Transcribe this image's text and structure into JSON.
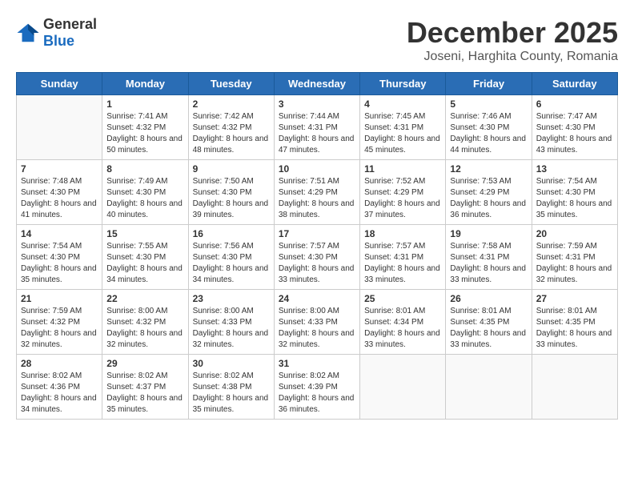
{
  "logo": {
    "general": "General",
    "blue": "Blue"
  },
  "title": "December 2025",
  "subtitle": "Joseni, Harghita County, Romania",
  "weekdays": [
    "Sunday",
    "Monday",
    "Tuesday",
    "Wednesday",
    "Thursday",
    "Friday",
    "Saturday"
  ],
  "weeks": [
    [
      {
        "day": "",
        "sunrise": "",
        "sunset": "",
        "daylight": ""
      },
      {
        "day": "1",
        "sunrise": "Sunrise: 7:41 AM",
        "sunset": "Sunset: 4:32 PM",
        "daylight": "Daylight: 8 hours and 50 minutes."
      },
      {
        "day": "2",
        "sunrise": "Sunrise: 7:42 AM",
        "sunset": "Sunset: 4:32 PM",
        "daylight": "Daylight: 8 hours and 48 minutes."
      },
      {
        "day": "3",
        "sunrise": "Sunrise: 7:44 AM",
        "sunset": "Sunset: 4:31 PM",
        "daylight": "Daylight: 8 hours and 47 minutes."
      },
      {
        "day": "4",
        "sunrise": "Sunrise: 7:45 AM",
        "sunset": "Sunset: 4:31 PM",
        "daylight": "Daylight: 8 hours and 45 minutes."
      },
      {
        "day": "5",
        "sunrise": "Sunrise: 7:46 AM",
        "sunset": "Sunset: 4:30 PM",
        "daylight": "Daylight: 8 hours and 44 minutes."
      },
      {
        "day": "6",
        "sunrise": "Sunrise: 7:47 AM",
        "sunset": "Sunset: 4:30 PM",
        "daylight": "Daylight: 8 hours and 43 minutes."
      }
    ],
    [
      {
        "day": "7",
        "sunrise": "Sunrise: 7:48 AM",
        "sunset": "Sunset: 4:30 PM",
        "daylight": "Daylight: 8 hours and 41 minutes."
      },
      {
        "day": "8",
        "sunrise": "Sunrise: 7:49 AM",
        "sunset": "Sunset: 4:30 PM",
        "daylight": "Daylight: 8 hours and 40 minutes."
      },
      {
        "day": "9",
        "sunrise": "Sunrise: 7:50 AM",
        "sunset": "Sunset: 4:30 PM",
        "daylight": "Daylight: 8 hours and 39 minutes."
      },
      {
        "day": "10",
        "sunrise": "Sunrise: 7:51 AM",
        "sunset": "Sunset: 4:29 PM",
        "daylight": "Daylight: 8 hours and 38 minutes."
      },
      {
        "day": "11",
        "sunrise": "Sunrise: 7:52 AM",
        "sunset": "Sunset: 4:29 PM",
        "daylight": "Daylight: 8 hours and 37 minutes."
      },
      {
        "day": "12",
        "sunrise": "Sunrise: 7:53 AM",
        "sunset": "Sunset: 4:29 PM",
        "daylight": "Daylight: 8 hours and 36 minutes."
      },
      {
        "day": "13",
        "sunrise": "Sunrise: 7:54 AM",
        "sunset": "Sunset: 4:30 PM",
        "daylight": "Daylight: 8 hours and 35 minutes."
      }
    ],
    [
      {
        "day": "14",
        "sunrise": "Sunrise: 7:54 AM",
        "sunset": "Sunset: 4:30 PM",
        "daylight": "Daylight: 8 hours and 35 minutes."
      },
      {
        "day": "15",
        "sunrise": "Sunrise: 7:55 AM",
        "sunset": "Sunset: 4:30 PM",
        "daylight": "Daylight: 8 hours and 34 minutes."
      },
      {
        "day": "16",
        "sunrise": "Sunrise: 7:56 AM",
        "sunset": "Sunset: 4:30 PM",
        "daylight": "Daylight: 8 hours and 34 minutes."
      },
      {
        "day": "17",
        "sunrise": "Sunrise: 7:57 AM",
        "sunset": "Sunset: 4:30 PM",
        "daylight": "Daylight: 8 hours and 33 minutes."
      },
      {
        "day": "18",
        "sunrise": "Sunrise: 7:57 AM",
        "sunset": "Sunset: 4:31 PM",
        "daylight": "Daylight: 8 hours and 33 minutes."
      },
      {
        "day": "19",
        "sunrise": "Sunrise: 7:58 AM",
        "sunset": "Sunset: 4:31 PM",
        "daylight": "Daylight: 8 hours and 33 minutes."
      },
      {
        "day": "20",
        "sunrise": "Sunrise: 7:59 AM",
        "sunset": "Sunset: 4:31 PM",
        "daylight": "Daylight: 8 hours and 32 minutes."
      }
    ],
    [
      {
        "day": "21",
        "sunrise": "Sunrise: 7:59 AM",
        "sunset": "Sunset: 4:32 PM",
        "daylight": "Daylight: 8 hours and 32 minutes."
      },
      {
        "day": "22",
        "sunrise": "Sunrise: 8:00 AM",
        "sunset": "Sunset: 4:32 PM",
        "daylight": "Daylight: 8 hours and 32 minutes."
      },
      {
        "day": "23",
        "sunrise": "Sunrise: 8:00 AM",
        "sunset": "Sunset: 4:33 PM",
        "daylight": "Daylight: 8 hours and 32 minutes."
      },
      {
        "day": "24",
        "sunrise": "Sunrise: 8:00 AM",
        "sunset": "Sunset: 4:33 PM",
        "daylight": "Daylight: 8 hours and 32 minutes."
      },
      {
        "day": "25",
        "sunrise": "Sunrise: 8:01 AM",
        "sunset": "Sunset: 4:34 PM",
        "daylight": "Daylight: 8 hours and 33 minutes."
      },
      {
        "day": "26",
        "sunrise": "Sunrise: 8:01 AM",
        "sunset": "Sunset: 4:35 PM",
        "daylight": "Daylight: 8 hours and 33 minutes."
      },
      {
        "day": "27",
        "sunrise": "Sunrise: 8:01 AM",
        "sunset": "Sunset: 4:35 PM",
        "daylight": "Daylight: 8 hours and 33 minutes."
      }
    ],
    [
      {
        "day": "28",
        "sunrise": "Sunrise: 8:02 AM",
        "sunset": "Sunset: 4:36 PM",
        "daylight": "Daylight: 8 hours and 34 minutes."
      },
      {
        "day": "29",
        "sunrise": "Sunrise: 8:02 AM",
        "sunset": "Sunset: 4:37 PM",
        "daylight": "Daylight: 8 hours and 35 minutes."
      },
      {
        "day": "30",
        "sunrise": "Sunrise: 8:02 AM",
        "sunset": "Sunset: 4:38 PM",
        "daylight": "Daylight: 8 hours and 35 minutes."
      },
      {
        "day": "31",
        "sunrise": "Sunrise: 8:02 AM",
        "sunset": "Sunset: 4:39 PM",
        "daylight": "Daylight: 8 hours and 36 minutes."
      },
      {
        "day": "",
        "sunrise": "",
        "sunset": "",
        "daylight": ""
      },
      {
        "day": "",
        "sunrise": "",
        "sunset": "",
        "daylight": ""
      },
      {
        "day": "",
        "sunrise": "",
        "sunset": "",
        "daylight": ""
      }
    ]
  ]
}
